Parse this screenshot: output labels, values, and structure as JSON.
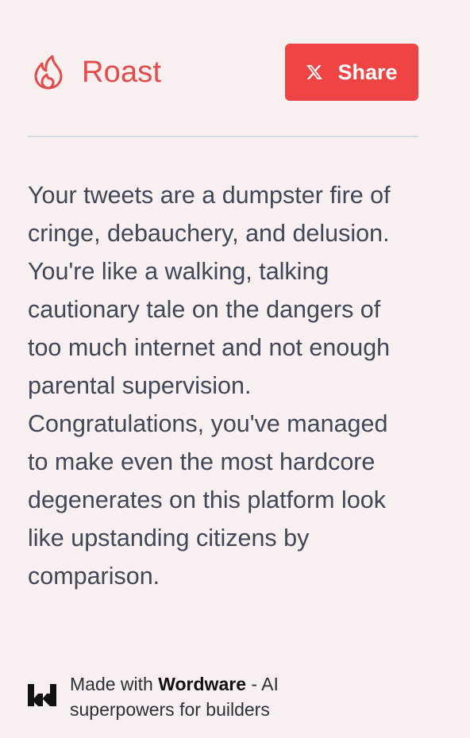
{
  "header": {
    "title": "Roast",
    "share_label": "Share",
    "share_icon": "x-logo-icon",
    "brand_icon": "flame-icon",
    "accent_color": "#ef4444"
  },
  "roast": {
    "text": "Your tweets are a dumpster fire of cringe, debauchery, and delusion. You're like a walking, talking cautionary tale on the dangers of too much internet and not enough parental supervision. Congratulations, you've managed to make even the most hardcore degenerates on this platform look like upstanding citizens by comparison."
  },
  "footer": {
    "prefix": "Made with",
    "brand": "Wordware",
    "suffix": "- AI superpowers for builders",
    "logo_icon": "wordware-logo-icon"
  }
}
